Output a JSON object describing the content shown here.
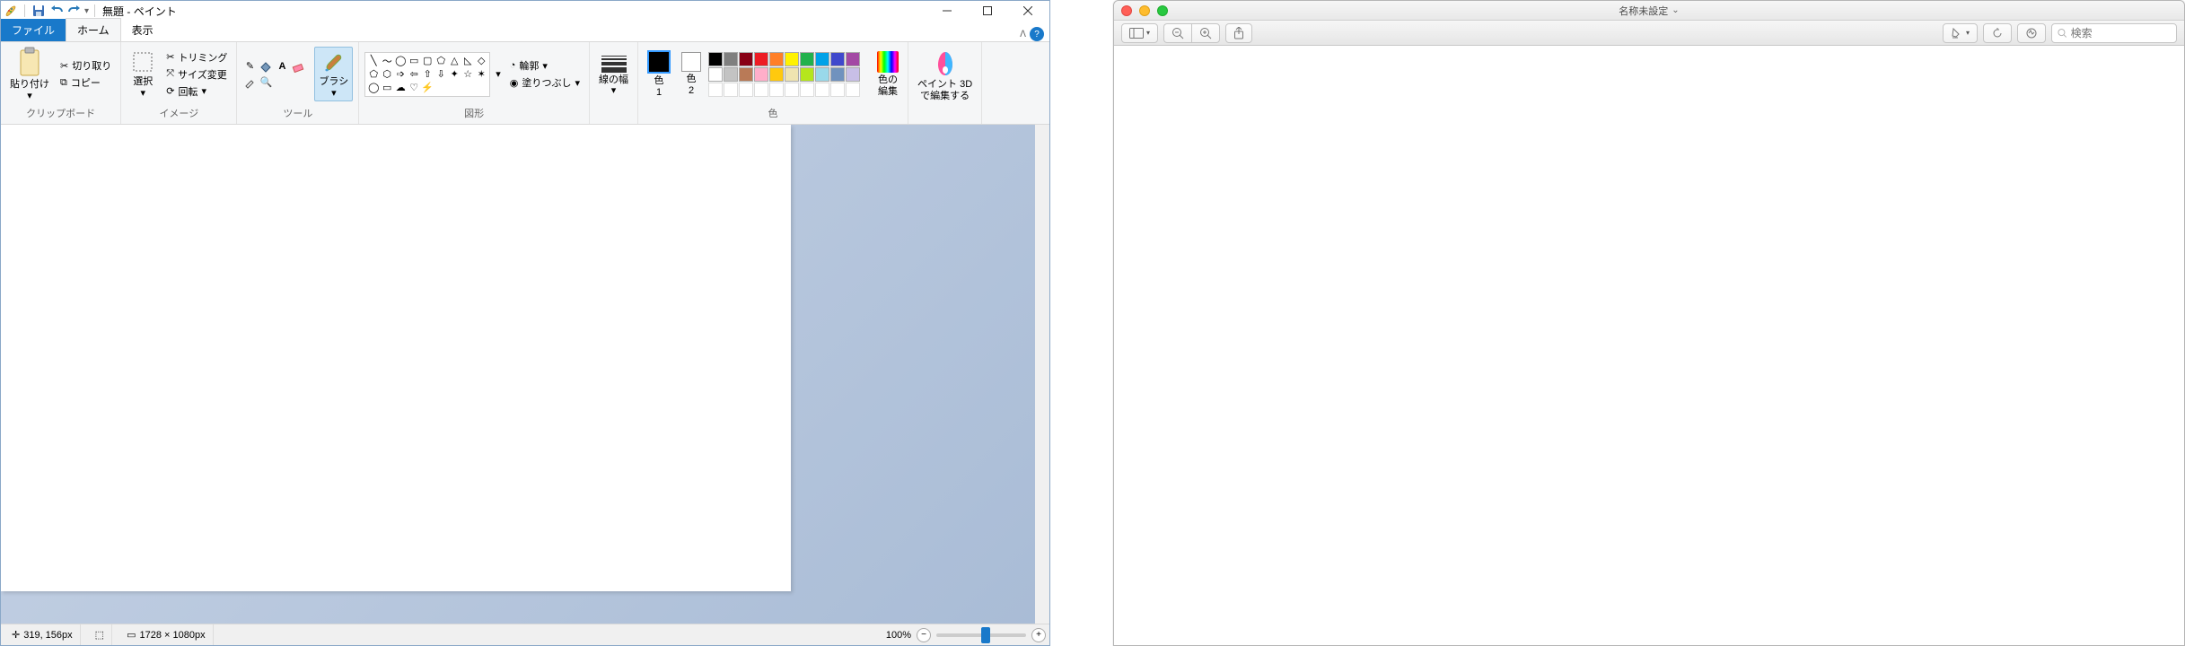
{
  "paint": {
    "title": "無題 - ペイント",
    "tabs": {
      "file": "ファイル",
      "home": "ホーム",
      "view": "表示"
    },
    "clipboard": {
      "paste": "貼り付け",
      "cut": "切り取り",
      "copy": "コピー",
      "label": "クリップボード"
    },
    "image": {
      "select": "選択",
      "crop": "トリミング",
      "resize": "サイズ変更",
      "rotate": "回転",
      "label": "イメージ"
    },
    "tools": {
      "label": "ツール",
      "brush": "ブラシ"
    },
    "shapes": {
      "outline": "輪郭",
      "fill": "塗りつぶし",
      "label": "図形"
    },
    "size": {
      "label": "線の幅"
    },
    "colors": {
      "c1": "色\n1",
      "c2": "色\n2",
      "edit": "色の\n編集",
      "label": "色",
      "palette": [
        "#000000",
        "#7f7f7f",
        "#880015",
        "#ed1c24",
        "#ff7f27",
        "#fff200",
        "#22b14c",
        "#00a2e8",
        "#3f48cc",
        "#a349a4",
        "#ffffff",
        "#c3c3c3",
        "#b97a57",
        "#ffaec9",
        "#ffc90e",
        "#efe4b0",
        "#b5e61d",
        "#99d9ea",
        "#7092be",
        "#c8bfe7"
      ]
    },
    "paint3d": {
      "line1": "ペイント 3D",
      "line2": "で編集する"
    },
    "status": {
      "pos": "319, 156px",
      "size": "1728 × 1080px",
      "zoom": "100%"
    }
  },
  "preview": {
    "title": "名称未設定",
    "search_placeholder": "検索"
  }
}
